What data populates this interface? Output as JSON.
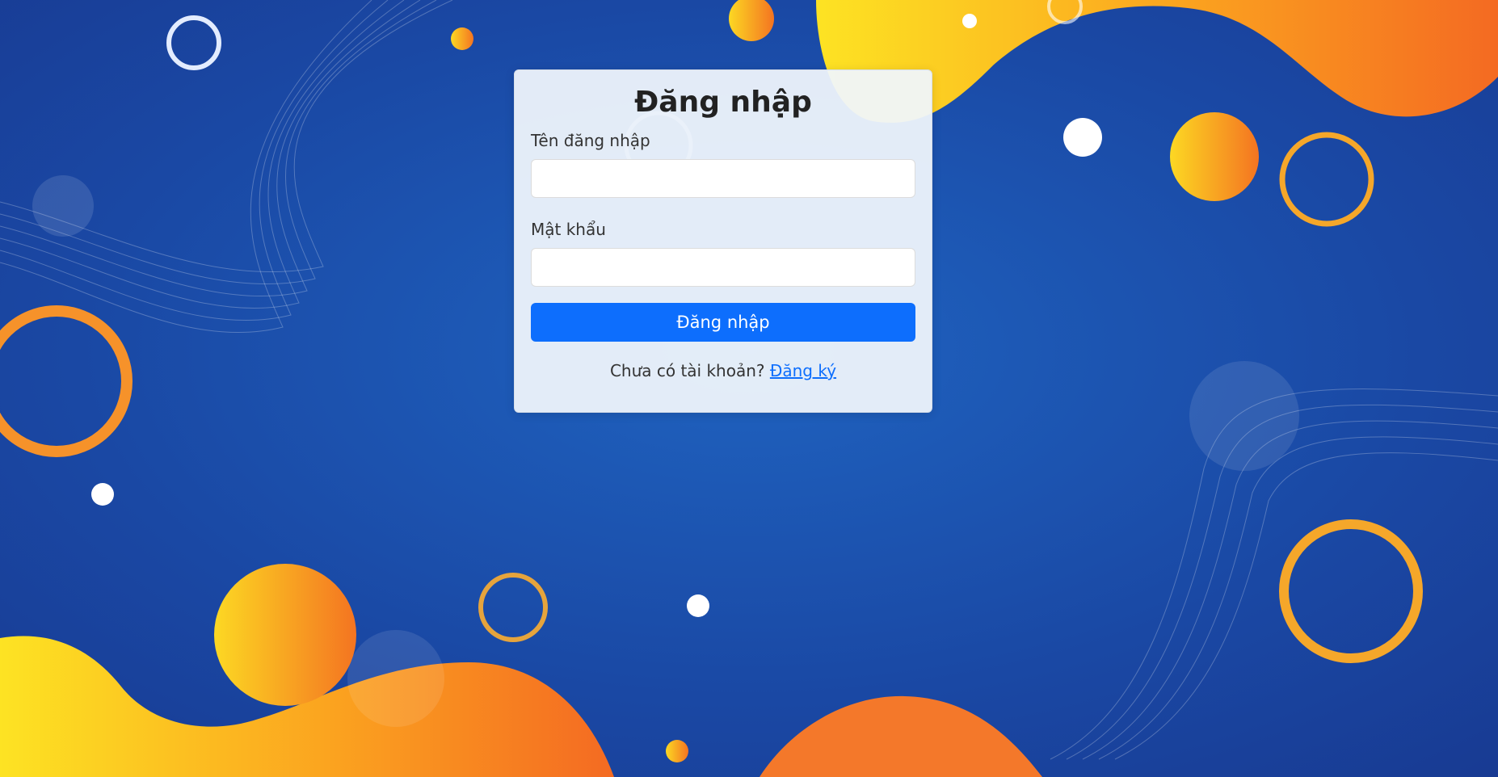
{
  "login": {
    "title": "Đăng nhập",
    "username_label": "Tên đăng nhập",
    "username_value": "",
    "password_label": "Mật khẩu",
    "password_value": "",
    "submit_label": "Đăng nhập",
    "register_prompt": "Chưa có tài khoản?",
    "register_link": "Đăng ký"
  },
  "colors": {
    "primary": "#0d6efd",
    "background_blue": "#1a4aa6",
    "accent_orange": "#f47a1e",
    "accent_yellow": "#fbd21e"
  }
}
